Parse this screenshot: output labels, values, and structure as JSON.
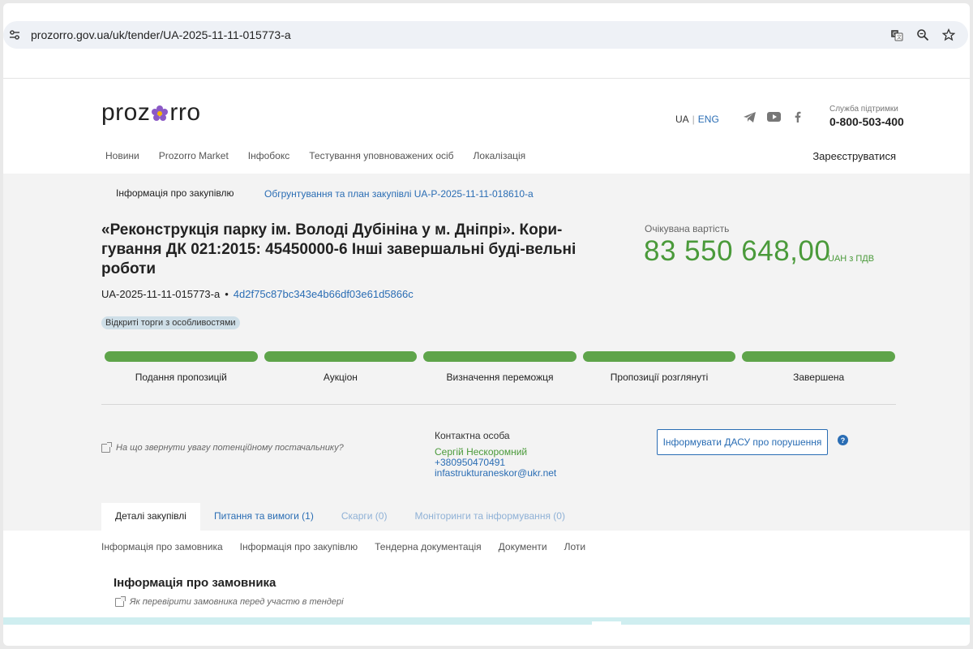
{
  "browser": {
    "url": "prozorro.gov.ua/uk/tender/UA-2025-11-11-015773-a",
    "icons": [
      "site-settings-icon",
      "translate-icon",
      "zoom-icon",
      "bookmark-star-icon"
    ]
  },
  "header": {
    "logo": {
      "pre": "proz",
      "post": "rro"
    },
    "lang_ua": "UA",
    "lang_sep": "|",
    "lang_eng": "ENG",
    "social": [
      "telegram-icon",
      "youtube-icon",
      "facebook-icon"
    ],
    "support_label": "Служба підтримки",
    "support_phone": "0-800-503-400",
    "nav": [
      "Новини",
      "Prozorro Market",
      "Інфобокс",
      "Тестування уповноважених осіб",
      "Локалізація"
    ],
    "register": "Зареєструватися"
  },
  "subnav": {
    "active": "Інформація про закупівлю",
    "link": "Обгрунтування та план закупівлі UA-P-2025-11-11-018610-a"
  },
  "tender": {
    "title": "«Реконструкція парку ім. Володі Дубініна у м. Дніпрі». Кори-гування ДК 021:2015: 45450000-6 Інші завершальні буді-вельні роботи",
    "expected_label": "Очікувана вартість",
    "expected_value": "83 550 648,00",
    "expected_currency": "UAH з ПДВ",
    "id": "UA-2025-11-11-015773-a",
    "dot": "•",
    "hash": "4d2f75c87bc343e4b66df03e61d5866c",
    "badge": "Відкриті торги з особливостями"
  },
  "stages": [
    {
      "label": "Подання пропозицій",
      "complete": true
    },
    {
      "label": "Аукціон",
      "complete": true
    },
    {
      "label": "Визначення переможця",
      "complete": true
    },
    {
      "label": "Пропозиції розглянуті",
      "complete": true
    },
    {
      "label": "Завершена",
      "complete": true
    }
  ],
  "colors": {
    "accent": "#2a6db4",
    "success": "#5ea44a",
    "value_green": "#4a9a3a"
  },
  "attention_link": "На що звернути увагу потенційному постачальнику?",
  "contact": {
    "heading": "Контактна особа",
    "name": "Сергій Нескоромний",
    "phone": "+380950470491",
    "email": "infastrukturaneskor@ukr.net"
  },
  "dasu_button": "Інформувати ДАСУ про порушення",
  "help_icon": "?",
  "tabs": [
    {
      "label": "Деталі закупівлі",
      "state": "active"
    },
    {
      "label": "Питання та вимоги (1)",
      "state": "link"
    },
    {
      "label": "Скарги (0)",
      "state": "muted"
    },
    {
      "label": "Моніторинги та інформування (0)",
      "state": "muted"
    }
  ],
  "subtabs": [
    "Інформація про замовника",
    "Інформація про закупівлю",
    "Тендерна документація",
    "Документи",
    "Лоти"
  ],
  "section": {
    "title": "Інформація про замовника",
    "check_link": "Як перевірити замовника перед участю в тендері"
  }
}
